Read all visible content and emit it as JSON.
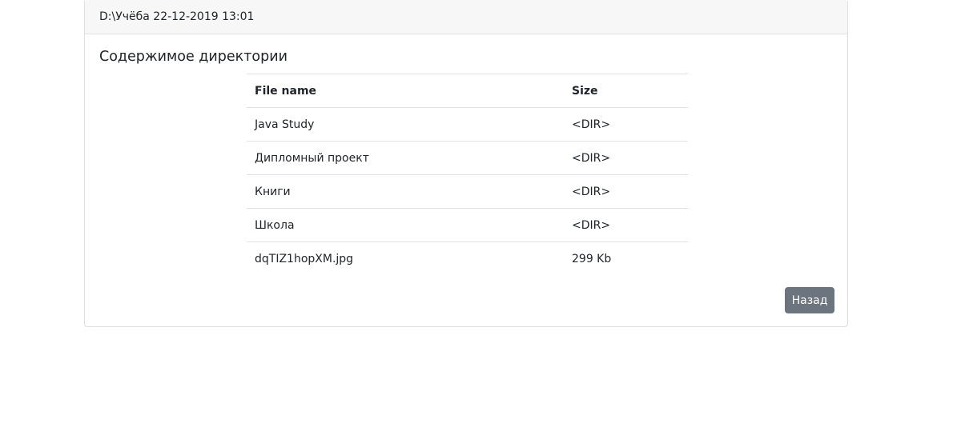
{
  "header": {
    "path_info": "D:\\Учёба 22-12-2019 13:01"
  },
  "main": {
    "title": "Содержимое директории",
    "table": {
      "columns": [
        "File name",
        "Size"
      ],
      "rows": [
        {
          "name": "Java Study",
          "size": "<DIR>"
        },
        {
          "name": "Дипломный проект",
          "size": "<DIR>"
        },
        {
          "name": "Книги",
          "size": "<DIR>"
        },
        {
          "name": "Школа",
          "size": "<DIR>"
        },
        {
          "name": "dqTIZ1hopXM.jpg",
          "size": "299 Kb"
        }
      ]
    },
    "back_label": "Назад"
  },
  "colors": {
    "button_bg": "#6c757d",
    "header_bg": "#f7f7f7",
    "border": "#dfdfdf"
  }
}
